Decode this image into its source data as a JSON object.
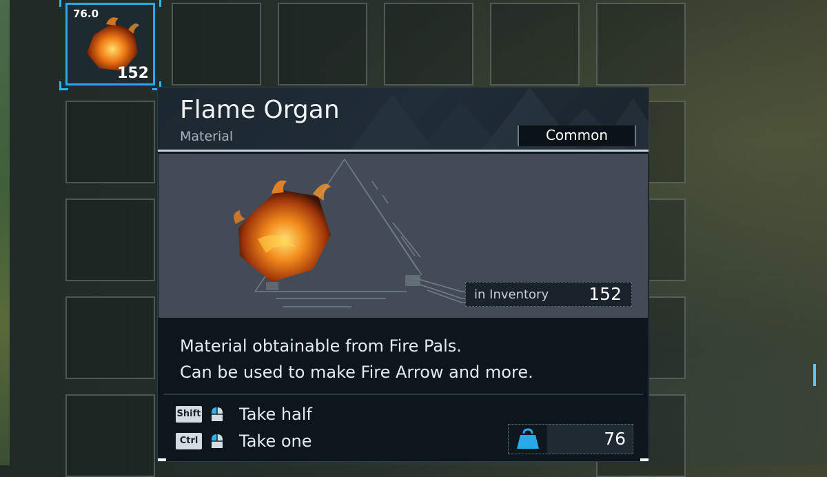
{
  "slot_selected": {
    "weight": "76.0",
    "count": "152"
  },
  "tooltip": {
    "title": "Flame Organ",
    "category": "Material",
    "rarity": "Common",
    "inventory_label": "in Inventory",
    "inventory_count": "152",
    "description_lines": [
      "Material obtainable from Fire Pals.",
      "Can be used to make Fire Arrow and more."
    ],
    "actions": [
      {
        "key": "Shift",
        "label": "Take half",
        "icon": "mouse-left-click-icon"
      },
      {
        "key": "Ctrl",
        "label": "Take one",
        "icon": "mouse-left-click-icon"
      }
    ],
    "weight_icon": "weight-icon",
    "weight_value": "76"
  },
  "colors": {
    "accent": "#29a9e8",
    "panel_bg": "#0d151d",
    "image_bg": "#434c56"
  }
}
